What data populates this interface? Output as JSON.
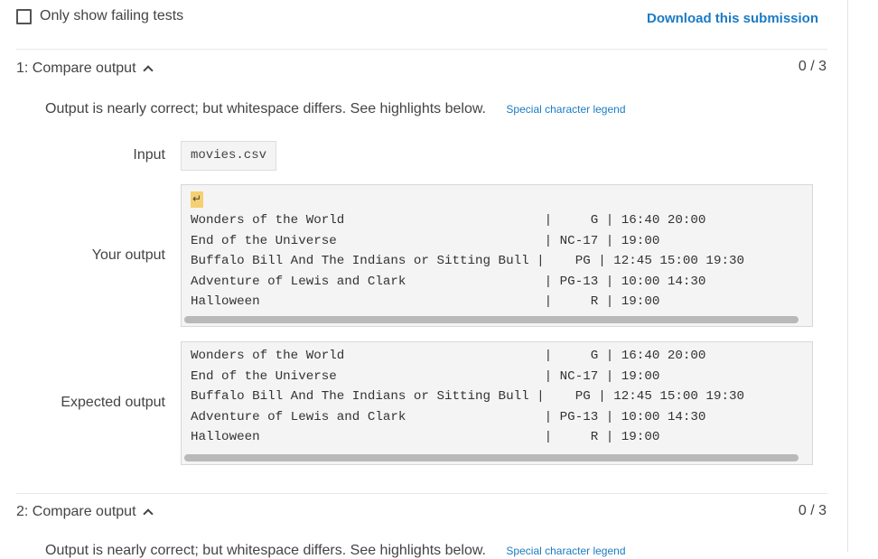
{
  "filter": {
    "label": "Only show failing tests"
  },
  "download": {
    "label": "Download this submission"
  },
  "tests": [
    {
      "title": "1: Compare output",
      "score": "0 / 3",
      "message": "Output is nearly correct; but whitespace differs. See highlights below.",
      "legend_label": "Special character legend",
      "input_label": "Input",
      "input_value": "movies.csv",
      "your_output_label": "Your output",
      "newline_symbol": "↵",
      "your_output_lines": [
        "Wonders of the World                          |     G | 16:40 20:00",
        "End of the Universe                           | NC-17 | 19:00",
        "Buffalo Bill And The Indians or Sitting Bull |    PG | 12:45 15:00 19:30",
        "Adventure of Lewis and Clark                  | PG-13 | 10:00 14:30",
        "Halloween                                     |     R | 19:00"
      ],
      "expected_output_label": "Expected output",
      "expected_output_lines": [
        "Wonders of the World                          |     G | 16:40 20:00",
        "End of the Universe                           | NC-17 | 19:00",
        "Buffalo Bill And The Indians or Sitting Bull |    PG | 12:45 15:00 19:30",
        "Adventure of Lewis and Clark                  | PG-13 | 10:00 14:30",
        "Halloween                                     |     R | 19:00"
      ]
    },
    {
      "title": "2: Compare output",
      "score": "0 / 3",
      "message": "Output is nearly correct; but whitespace differs. See highlights below.",
      "legend_label": "Special character legend"
    }
  ],
  "colors": {
    "link": "#1b7bc4",
    "highlight": "#f6cf71"
  }
}
